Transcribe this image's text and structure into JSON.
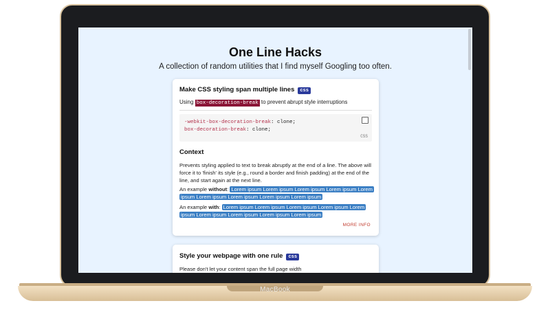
{
  "device": {
    "brand": "MacBook"
  },
  "page": {
    "title": "One Line Hacks",
    "subtitle": "A collection of random utilities that I find myself Googling too often."
  },
  "card1": {
    "heading": "Make CSS styling span multiple lines",
    "badge": "css",
    "using_prefix": "Using",
    "using_code": "box-decoration-break",
    "using_suffix": " to prevent abrupt style interruptions",
    "code": {
      "line1_prop": "-webkit-box-decoration-break",
      "line1_val": ": clone;",
      "line2_prop": "box-decoration-break",
      "line2_val": ": clone;",
      "language": "CSS",
      "copy_icon": "copy-icon"
    },
    "context_heading": "Context",
    "context_text": "Prevents styling applied to text to break abruptly at the end of a line. The above will force it to 'finish' its style (e.g., round a border and finish padding) at the end of the line, and start again at the next line.",
    "without_prefix": "An example ",
    "without_bold": "without",
    "without_sep": ": ",
    "without_text": "Lorem ipsum Lorem ipsum Lorem ipsum Lorem ipsum Lorem ipsum Lorem ipsum Lorem ipsum Lorem ipsum Lorem ipsum",
    "with_prefix": "An example ",
    "with_bold": "with",
    "with_sep": ": ",
    "with_text": "Lorem ipsum Lorem ipsum Lorem ipsum Lorem ipsum Lorem ipsum Lorem ipsum Lorem ipsum Lorem ipsum Lorem ipsum",
    "more_info": "MORE INFO"
  },
  "card2": {
    "heading": "Style your webpage with one rule",
    "badge": "css",
    "text": "Please don't let your content span the full page width"
  },
  "colors": {
    "screen_bg": "#e8f3ff",
    "badge": "#2a3a9b",
    "inline_code": "#8a1436",
    "highlight": "#3b7fc4",
    "more_info": "#c0392b"
  }
}
